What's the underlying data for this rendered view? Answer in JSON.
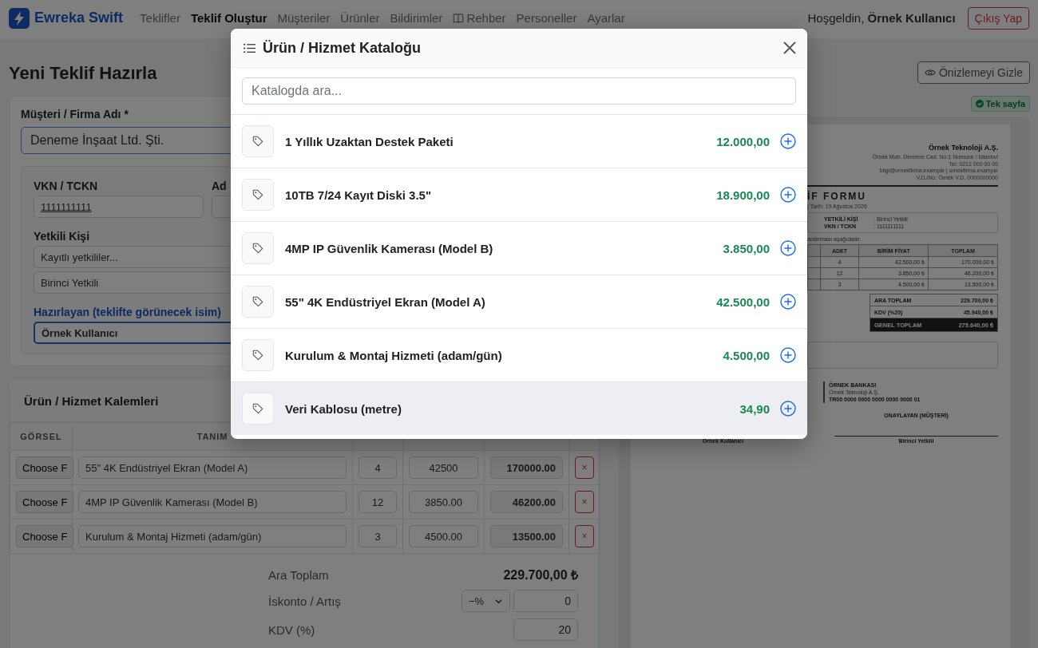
{
  "navbar": {
    "brand": "Ewreka Swift",
    "links": [
      {
        "label": "Teklifler",
        "selected": false,
        "kind": "text"
      },
      {
        "label": "Teklif Oluştur",
        "selected": true,
        "kind": "text"
      },
      {
        "label": "Müşteriler",
        "selected": false,
        "kind": "text"
      },
      {
        "label": "Ürünler",
        "selected": false,
        "kind": "text"
      },
      {
        "label": "Bildirimler",
        "selected": false,
        "kind": "text"
      },
      {
        "label": "Rehber",
        "selected": false,
        "kind": "guide"
      },
      {
        "label": "Personeller",
        "selected": false,
        "kind": "text"
      },
      {
        "label": "Ayarlar",
        "selected": false,
        "kind": "text"
      }
    ],
    "greeting": "Hoşgeldin, **Örnek Kullanıcı**",
    "logout": "Çıkış Yap"
  },
  "page_title": "Yeni Teklif Hazırla",
  "customer": {
    "label": "Müşteri / Firma Adı *",
    "value": "Deneme İnşaat Ltd. Şti.",
    "tax_id_label": "VKN / TCKN",
    "tax_id": "1111111111",
    "column_2_label": "Ad",
    "contact_label": "Yetkili Kişi",
    "contact_select": "Kayıtlı yetkililer...",
    "contact_value": "Birinci Yetkili",
    "preparer_label": "Hazırlayan (teklifte görünecek isim)",
    "preparer_value": "Örnek Kullanıcı"
  },
  "items": {
    "title": "Ürün / Hizmet Kalemleri",
    "columns": [
      "GÖRSEL",
      "TANIM"
    ],
    "rows": [
      {
        "file_button": "Choose F",
        "description": "55\" 4K Endüstriyel Ekran (Model A)",
        "quantity": "4",
        "unit_price": "42500",
        "total": "170000.00",
        "remove": "×"
      },
      {
        "file_button": "Choose F",
        "description": "4MP IP Güvenlik Kamerası (Model B)",
        "quantity": "12",
        "unit_price": "3850.00",
        "total": "46200.00",
        "remove": "×"
      },
      {
        "file_button": "Choose F",
        "description": "Kurulum & Montaj Hizmeti (adam/gün)",
        "quantity": "3",
        "unit_price": "4500.00",
        "total": "13500.00",
        "remove": "×"
      }
    ],
    "subtotal_label": "Ara Toplam",
    "subtotal": "229.700,00 ₺",
    "discount_label": "İskonto / Artış",
    "discount_mode": "−%",
    "discount": "0",
    "vat_label": "KDV (%)",
    "vat": "20"
  },
  "preview": {
    "toggle": "Önizlemeyi Gizle",
    "badge": "Tek sayfa",
    "company": "Örnek Teknoloji A.Ş.",
    "company_lines": [
      "Örnek Mah. Deneme Cad. No:1 Numune / İstanbul",
      "Tel: 0212 000 00 00",
      "bilgi@ornekfirma.example | ornekfirma.example",
      "V.D./No: Örnek V.D. 0000000000"
    ],
    "title": "İF FORMU",
    "date_line": "| Tarih: 19 Ağustos 2026",
    "info": [
      {
        "label": "YETKİLİ KİŞİ",
        "value": ": Birinci Yetkili"
      },
      {
        "label": "VKN / TCKN",
        "value": ": 1111111111"
      }
    ],
    "note": "andırması aşağıdadır.",
    "columns": [
      "ADET",
      "BİRİM FİYAT",
      "TOPLAM"
    ],
    "rows": [
      {
        "quantity": "4",
        "unit_price": "42.500,00 ₺",
        "total": "170.000,00 ₺"
      },
      {
        "quantity": "12",
        "unit_price": "3.850,00 ₺",
        "total": "46.200,00 ₺"
      },
      {
        "quantity": "3",
        "unit_price": "4.500,00 ₺",
        "total": "13.500,00 ₺"
      }
    ],
    "totals": [
      {
        "label": "ARA TOPLAM",
        "value": "229.700,00 ₺",
        "kind": "normal"
      },
      {
        "label": "KDV (%20)",
        "value": "45.940,00 ₺",
        "kind": "normal"
      },
      {
        "label": "GENEL TOPLAM",
        "value": "275.640,00 ₺",
        "kind": "grand"
      }
    ],
    "bank": {
      "name": "ÖRNEK BANKASI",
      "holder": "Örnek Teknoloji A.Ş.",
      "iban": "TR00 0000 0000 0000 0000 0000 01"
    },
    "approver_heading": "ONAYLAYAN (MÜŞTERİ)",
    "signatures": [
      "Örnek Kullanıcı",
      "Birinci Yetkili"
    ]
  },
  "modal": {
    "title": "Ürün / Hizmet Kataloğu",
    "search": {
      "placeholder": "Katalogda ara..."
    },
    "products": [
      {
        "name": "1 Yıllık Uzaktan Destek Paketi",
        "price": "12.000,00",
        "hovered": false
      },
      {
        "name": "10TB 7/24 Kayıt Diski 3.5\"",
        "price": "18.900,00",
        "hovered": false
      },
      {
        "name": "4MP IP Güvenlik Kamerası (Model B)",
        "price": "3.850,00",
        "hovered": false
      },
      {
        "name": "55\" 4K Endüstriyel Ekran (Model A)",
        "price": "42.500,00",
        "hovered": false
      },
      {
        "name": "Kurulum & Montaj Hizmeti (adam/gün)",
        "price": "4.500,00",
        "hovered": false
      },
      {
        "name": "Veri Kablosu (metre)",
        "price": "34,90",
        "hovered": true
      }
    ]
  }
}
